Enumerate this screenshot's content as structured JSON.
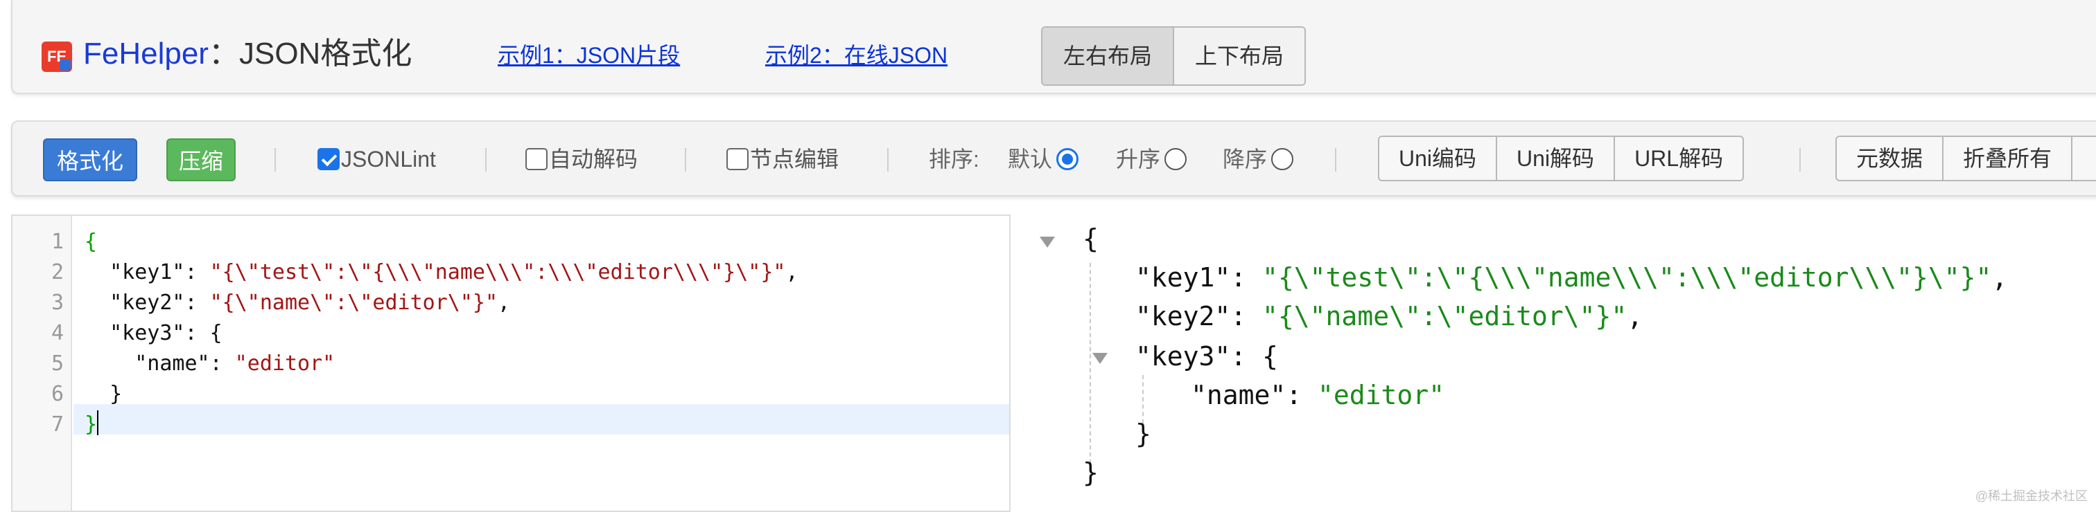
{
  "header": {
    "logo_text": "FE",
    "app_name": "FeHelper",
    "separator": "：",
    "page_title": "JSON格式化",
    "example1": "示例1：JSON片段",
    "example2": "示例2：在线JSON",
    "layout_left_right": "左右布局",
    "layout_top_bottom": "上下布局"
  },
  "toolbar": {
    "format_button": "格式化",
    "compress_button": "压缩",
    "jsonlint_label": "JSONLint",
    "auto_decode_label": "自动解码",
    "node_edit_label": "节点编辑",
    "sort_label": "排序:",
    "sort_default": "默认",
    "sort_asc": "升序",
    "sort_desc": "降序",
    "uni_encode": "Uni编码",
    "uni_decode": "Uni解码",
    "url_decode": "URL解码",
    "metadata": "元数据",
    "collapse_all": "折叠所有"
  },
  "editor": {
    "line_numbers": [
      "1",
      "2",
      "3",
      "4",
      "5",
      "6",
      "7"
    ],
    "line1_brace": "{",
    "line2_key": "  \"key1\"",
    "line2_colon": ": ",
    "line2_value": "\"{\\\"test\\\":\\\"{\\\\\\\"name\\\\\\\":\\\\\\\"editor\\\\\\\"}\\\"}\"",
    "line2_comma": ",",
    "line3_key": "  \"key2\"",
    "line3_colon": ": ",
    "line3_value": "\"{\\\"name\\\":\\\"editor\\\"}\"",
    "line3_comma": ",",
    "line4_key": "  \"key3\"",
    "line4_rest": ": {",
    "line5_key": "    \"name\"",
    "line5_colon": ": ",
    "line5_value": "\"editor\"",
    "line6": "  }",
    "line7_brace": "}"
  },
  "viewer": {
    "open_brace": "{",
    "key1": "\"key1\"",
    "key1_value": "\"{\\\"test\\\":\\\"{\\\\\\\"name\\\\\\\":\\\\\\\"editor\\\\\\\"}\\\"}\"",
    "key2": "\"key2\"",
    "key2_value": "\"{\\\"name\\\":\\\"editor\\\"}\"",
    "key3": "\"key3\"",
    "key3_open": ": {",
    "name_key": "\"name\"",
    "name_value": "\"editor\"",
    "colon": ": ",
    "comma": ",",
    "inner_close": "}",
    "close_brace": "}"
  },
  "watermark": "@稀土掘金技术社区",
  "colors": {
    "accent_blue": "#3a7bd5",
    "success_green": "#5cb85c",
    "link_blue": "#0b34d8",
    "string_red": "#a31515",
    "string_green": "#1a8a1a"
  }
}
